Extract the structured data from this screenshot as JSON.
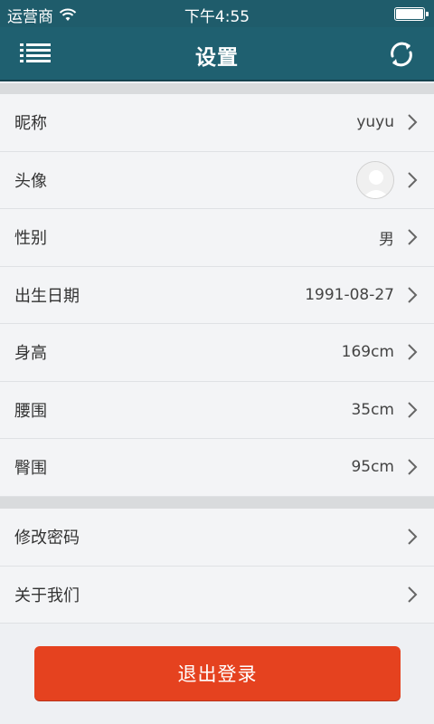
{
  "status_bar": {
    "carrier": "运营商",
    "time": "下午4:55",
    "icons": [
      "wifi-icon",
      "battery-icon"
    ]
  },
  "header": {
    "title": "设置",
    "left_icon": "menu-list-icon",
    "right_icon": "refresh-icon"
  },
  "profile_rows": [
    {
      "label": "昵称",
      "value": "yuyu"
    },
    {
      "label": "头像",
      "value": null,
      "type": "avatar"
    },
    {
      "label": "性别",
      "value": "男"
    },
    {
      "label": "出生日期",
      "value": "1991-08-27"
    },
    {
      "label": "身高",
      "value": "169cm"
    },
    {
      "label": "腰围",
      "value": "35cm"
    },
    {
      "label": "臀围",
      "value": "95cm"
    }
  ],
  "account_rows": [
    {
      "label": "修改密码"
    },
    {
      "label": "关于我们"
    }
  ],
  "logout_button": {
    "label": "退出登录"
  },
  "colors": {
    "header_bg": "#1f6070",
    "logout_bg": "#e5421f"
  }
}
